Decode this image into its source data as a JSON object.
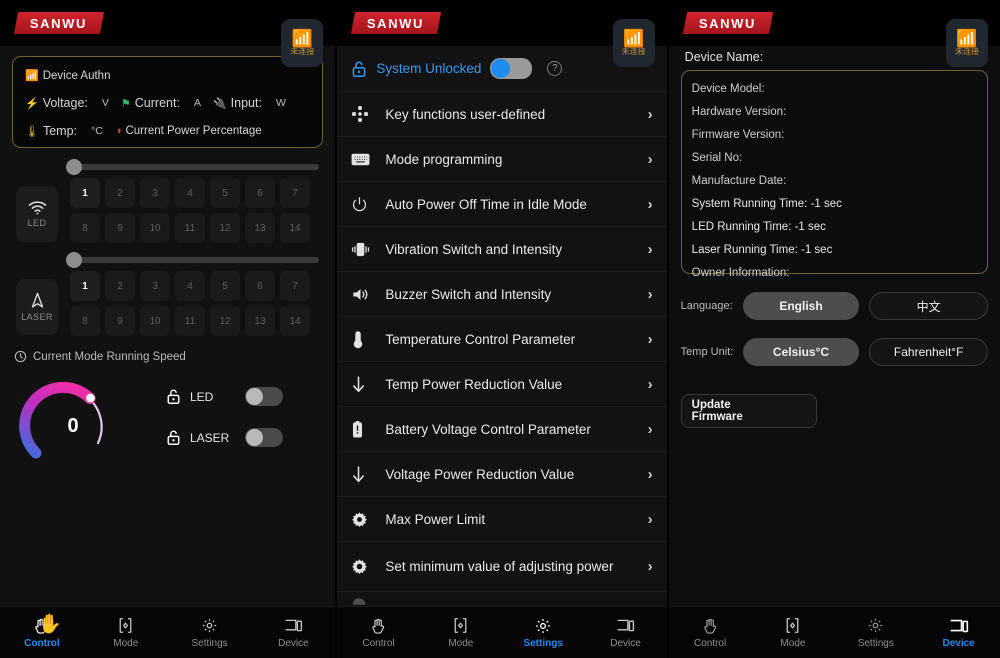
{
  "brand": {
    "logo_text": "SANWU"
  },
  "bluetooth": {
    "icon": "bluetooth-icon",
    "status_label": "未连接"
  },
  "control_panel": {
    "status_card": {
      "auth_label": "Device Authn",
      "voltage_label": "Voltage:",
      "voltage_unit": "V",
      "current_label": "Current:",
      "current_unit": "A",
      "input_label": "Input:",
      "input_unit": "W",
      "temp_label": "Temp:",
      "temp_unit": "°C",
      "power_percentage_label": "Current Power Percentage"
    },
    "led": {
      "group_label": "LED",
      "icon": "wifi-signal-icon",
      "slider_value": 0,
      "keys": [
        "1",
        "2",
        "3",
        "4",
        "5",
        "6",
        "7",
        "8",
        "9",
        "10",
        "11",
        "12",
        "13",
        "14"
      ],
      "active_key": "1"
    },
    "laser": {
      "group_label": "LASER",
      "icon": "navigation-arrow-icon",
      "slider_value": 0,
      "keys": [
        "1",
        "2",
        "3",
        "4",
        "5",
        "6",
        "7",
        "8",
        "9",
        "10",
        "11",
        "12",
        "13",
        "14"
      ],
      "active_key": "1"
    },
    "speed": {
      "title": "Current Mode Running Speed",
      "icon": "clock-icon",
      "value": "0",
      "gauge_min": 0,
      "gauge_max": 100,
      "gauge_gradient_from": "#3a6ee0",
      "gauge_gradient_to": "#f02ea8"
    },
    "locks": [
      {
        "label": "LED",
        "icon": "unlock-icon",
        "enabled": false
      },
      {
        "label": "LASER",
        "icon": "unlock-icon",
        "enabled": false
      }
    ]
  },
  "settings_panel": {
    "lock_bar": {
      "label": "System Unlocked",
      "icon": "unlock-icon",
      "toggle_on": true,
      "help_icon": "question-mark-icon"
    },
    "items": [
      {
        "label": "Key functions user-defined",
        "icon": "dpad-icon"
      },
      {
        "label": "Mode programming",
        "icon": "keyboard-icon"
      },
      {
        "label": "Auto Power Off Time in Idle Mode",
        "icon": "power-icon"
      },
      {
        "label": "Vibration Switch and Intensity",
        "icon": "vibration-icon"
      },
      {
        "label": "Buzzer Switch and Intensity",
        "icon": "speaker-icon"
      },
      {
        "label": "Temperature Control Parameter",
        "icon": "thermometer-icon"
      },
      {
        "label": "Temp Power Reduction Value",
        "icon": "arrow-down-icon"
      },
      {
        "label": "Battery Voltage Control Parameter",
        "icon": "battery-icon"
      },
      {
        "label": "Voltage Power Reduction Value",
        "icon": "arrow-down-icon"
      },
      {
        "label": "Max Power Limit",
        "icon": "gear-filled-icon"
      },
      {
        "label": "Set minimum value of adjusting power",
        "icon": "gear-icon"
      }
    ],
    "chevron": "›"
  },
  "device_panel": {
    "device_name_label": "Device Name:",
    "info": [
      {
        "label": "Device Model:",
        "value": ""
      },
      {
        "label": "Hardware Version:",
        "value": ""
      },
      {
        "label": "Firmware Version:",
        "value": ""
      },
      {
        "label": "Serial No:",
        "value": ""
      },
      {
        "label": "Manufacture Date:",
        "value": ""
      },
      {
        "label": "System Running Time:",
        "value": "-1 sec"
      },
      {
        "label": "LED Running Time:",
        "value": "-1 sec"
      },
      {
        "label": "Laser Running Time:",
        "value": "-1 sec"
      },
      {
        "label": "Owner Information:",
        "value": ""
      }
    ],
    "language": {
      "label": "Language:",
      "options": [
        "English",
        "中文"
      ],
      "selected": "English"
    },
    "temp_unit": {
      "label": "Temp Unit:",
      "options": [
        "Celsius°C",
        "Fahrenheit°F"
      ],
      "selected": "Celsius°C"
    },
    "update_firmware_label": "Update Firmware",
    "update_firmware_line1": "Update",
    "update_firmware_line2": "Firmware"
  },
  "nav": {
    "tabs": [
      {
        "label": "Control",
        "icon": "hand-icon"
      },
      {
        "label": "Mode",
        "icon": "mode-brackets-icon"
      },
      {
        "label": "Settings",
        "icon": "gear-icon"
      },
      {
        "label": "Device",
        "icon": "devices-icon"
      }
    ],
    "active_panel_1": "Control",
    "active_panel_2": "Settings",
    "active_panel_3": "Device"
  },
  "cursor": {
    "icon": "hand-cursor"
  }
}
